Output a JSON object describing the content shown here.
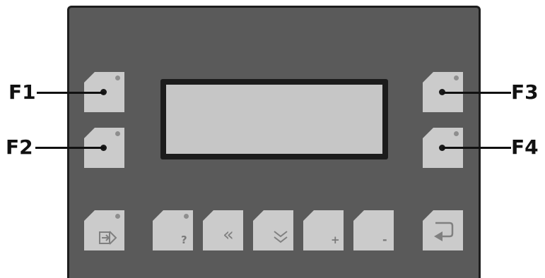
{
  "labels": {
    "f1": "F1",
    "f2": "F2",
    "f3": "F3",
    "f4": "F4"
  },
  "bottom_keys": {
    "help_symbol": "?",
    "left_symbol": "«",
    "plus_symbol": "+",
    "minus_symbol": "-"
  },
  "icons": {
    "export": "export-icon",
    "help": "help-icon",
    "left": "double-left-arrow-icon",
    "down": "double-down-arrow-icon",
    "plus": "plus-icon",
    "minus": "minus-icon",
    "enter": "enter-icon"
  },
  "colors": {
    "panel": "#5a5a5a",
    "key": "#cbcbcb",
    "lcd": "#c6c6c6",
    "label": "#111111"
  }
}
